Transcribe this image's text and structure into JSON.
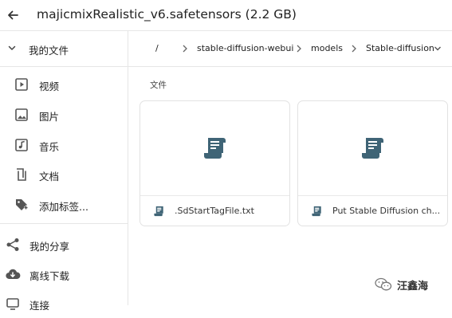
{
  "header": {
    "title": "majicmixRealistic_v6.safetensors (2.2 GB)"
  },
  "sidebar": {
    "section_label": "我的文件",
    "items": [
      {
        "label": "视频",
        "icon": "video-icon"
      },
      {
        "label": "图片",
        "icon": "image-icon"
      },
      {
        "label": "音乐",
        "icon": "music-icon"
      },
      {
        "label": "文档",
        "icon": "document-icon"
      },
      {
        "label": "添加标签...",
        "icon": "tag-icon"
      }
    ],
    "secondary": [
      {
        "label": "我的分享",
        "icon": "share-icon"
      },
      {
        "label": "离线下载",
        "icon": "cloud-download-icon"
      },
      {
        "label": "连接",
        "icon": "link-icon"
      }
    ]
  },
  "breadcrumb": [
    "/",
    "stable-diffusion-webui",
    "models",
    "Stable-diffusion"
  ],
  "content": {
    "section_label": "文件",
    "files": [
      {
        "name": ".SdStartTagFile.txt"
      },
      {
        "name": "Put Stable Diffusion ch..."
      }
    ]
  },
  "watermark": {
    "text": "汪鑫海"
  },
  "colors": {
    "file_icon": "#3f6476",
    "icon_gray": "#555555"
  }
}
